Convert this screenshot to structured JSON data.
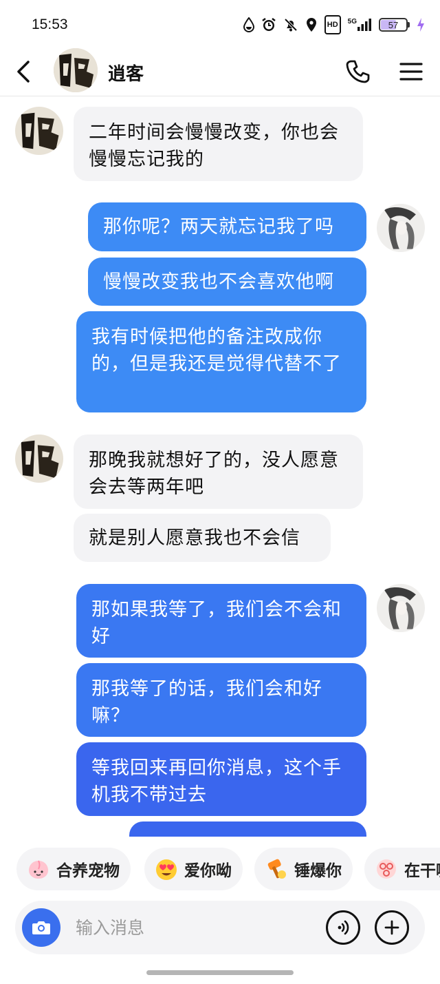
{
  "status_bar": {
    "time": "15:53",
    "hd": "HD",
    "network": "5G",
    "battery": "57",
    "battery_level": 0.57
  },
  "header": {
    "contact_name": "逍客",
    "icons": [
      "chevron-left-icon",
      "phone-icon",
      "menu-icon"
    ]
  },
  "messages": [
    {
      "from": "contact",
      "text": "二年时间会慢慢改变，你也会慢慢忘记我的"
    },
    {
      "from": "me",
      "text": "那你呢？两天就忘记我了吗"
    },
    {
      "from": "me",
      "text": "慢慢改变我也不会喜欢他啊"
    },
    {
      "from": "me",
      "text": "我有时候把他的备注改成你的，但是我还是觉得代替不了"
    },
    {
      "from": "contact",
      "text": "那晚我就想好了的，没人愿意会去等两年吧"
    },
    {
      "from": "contact",
      "text": "就是别人愿意我也不会信"
    },
    {
      "from": "me",
      "text": "那如果我等了，我们会不会和好"
    },
    {
      "from": "me",
      "text": "那我等了的话，我们会和好嘛？"
    },
    {
      "from": "me",
      "text": "等我回来再回你消息，这个手机我不带过去"
    }
  ],
  "quick_replies": [
    {
      "label": "合养宠物",
      "icon": "peach-pet-icon"
    },
    {
      "label": "爱你呦",
      "icon": "heart-eyes-emoji-icon"
    },
    {
      "label": "锤爆你",
      "icon": "hammer-icon"
    },
    {
      "label": "在干嘛",
      "icon": "face-blob-icon"
    }
  ],
  "input": {
    "placeholder": "输入消息"
  },
  "colors": {
    "bubble_out_1": "#3d8bf5",
    "bubble_out_2": "#3a78f2",
    "bubble_out_3": "#3a66ee",
    "bubble_in": "#f3f3f5",
    "camera_button": "#3a6fee"
  }
}
